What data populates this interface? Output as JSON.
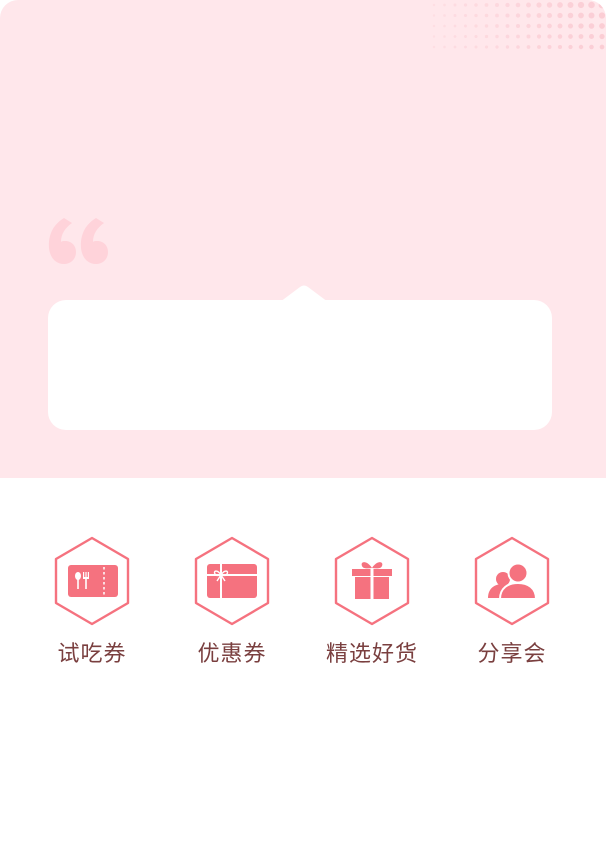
{
  "colors": {
    "hero_bg": "#ffe7eb",
    "accent": "#f5727f",
    "dots": "#fbcdd4",
    "label": "#7a3f3f"
  },
  "menu": {
    "items": [
      {
        "label": "试吃券",
        "icon": "tasting-ticket-icon"
      },
      {
        "label": "优惠券",
        "icon": "coupon-card-icon"
      },
      {
        "label": "精选好货",
        "icon": "gift-box-icon"
      },
      {
        "label": "分享会",
        "icon": "people-group-icon"
      }
    ]
  }
}
